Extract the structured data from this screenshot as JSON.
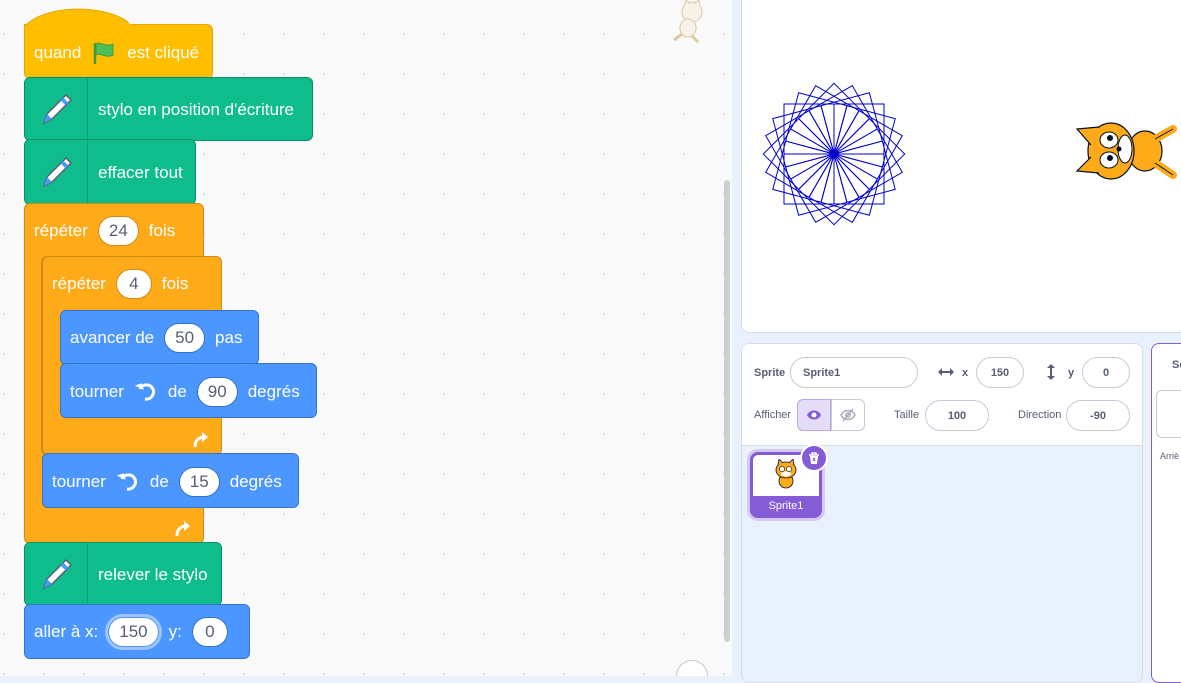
{
  "code": {
    "hat": {
      "label_start": "quand",
      "label_end": "est cliqué",
      "flag_color": "#4cbf56"
    },
    "pen_down": {
      "label": "stylo en position d'écriture"
    },
    "clear": {
      "label": "effacer tout"
    },
    "repeat_outer": {
      "label_start": "répéter",
      "value": "24",
      "label_end": "fois"
    },
    "repeat_inner": {
      "label_start": "répéter",
      "value": "4",
      "label_end": "fois"
    },
    "move": {
      "label_start": "avancer de",
      "value": "50",
      "label_end": "pas"
    },
    "turn_inner": {
      "label_start": "tourner",
      "label_mid": "de",
      "value": "90",
      "label_end": "degrés"
    },
    "turn_outer": {
      "label_start": "tourner",
      "label_mid": "de",
      "value": "15",
      "label_end": "degrés"
    },
    "pen_up": {
      "label": "relever le stylo"
    },
    "goto": {
      "label_start": "aller à x:",
      "x_value": "150",
      "label_y": "y:",
      "y_value": "0"
    }
  },
  "colors": {
    "events": "#ffbf00",
    "control": "#ffab19",
    "motion": "#4c97ff",
    "pen": "#0fbd8c",
    "sprite_accent": "#855cd6",
    "drawing": "#0000cc"
  },
  "stage": {
    "drawing": "spirograph of 24 rotated squares",
    "sprite": "cat-sprite"
  },
  "sprite_info": {
    "sprite_label": "Sprite",
    "sprite_name": "Sprite1",
    "x_label": "x",
    "x_value": "150",
    "y_label": "y",
    "y_value": "0",
    "show_label": "Afficher",
    "size_label": "Taille",
    "size_value": "100",
    "direction_label": "Direction",
    "direction_value": "-90"
  },
  "sprites": [
    {
      "name": "Sprite1",
      "selected": true
    }
  ],
  "stage_pane": {
    "tab_label": "Sc",
    "backdrop_label": "Arriè"
  }
}
